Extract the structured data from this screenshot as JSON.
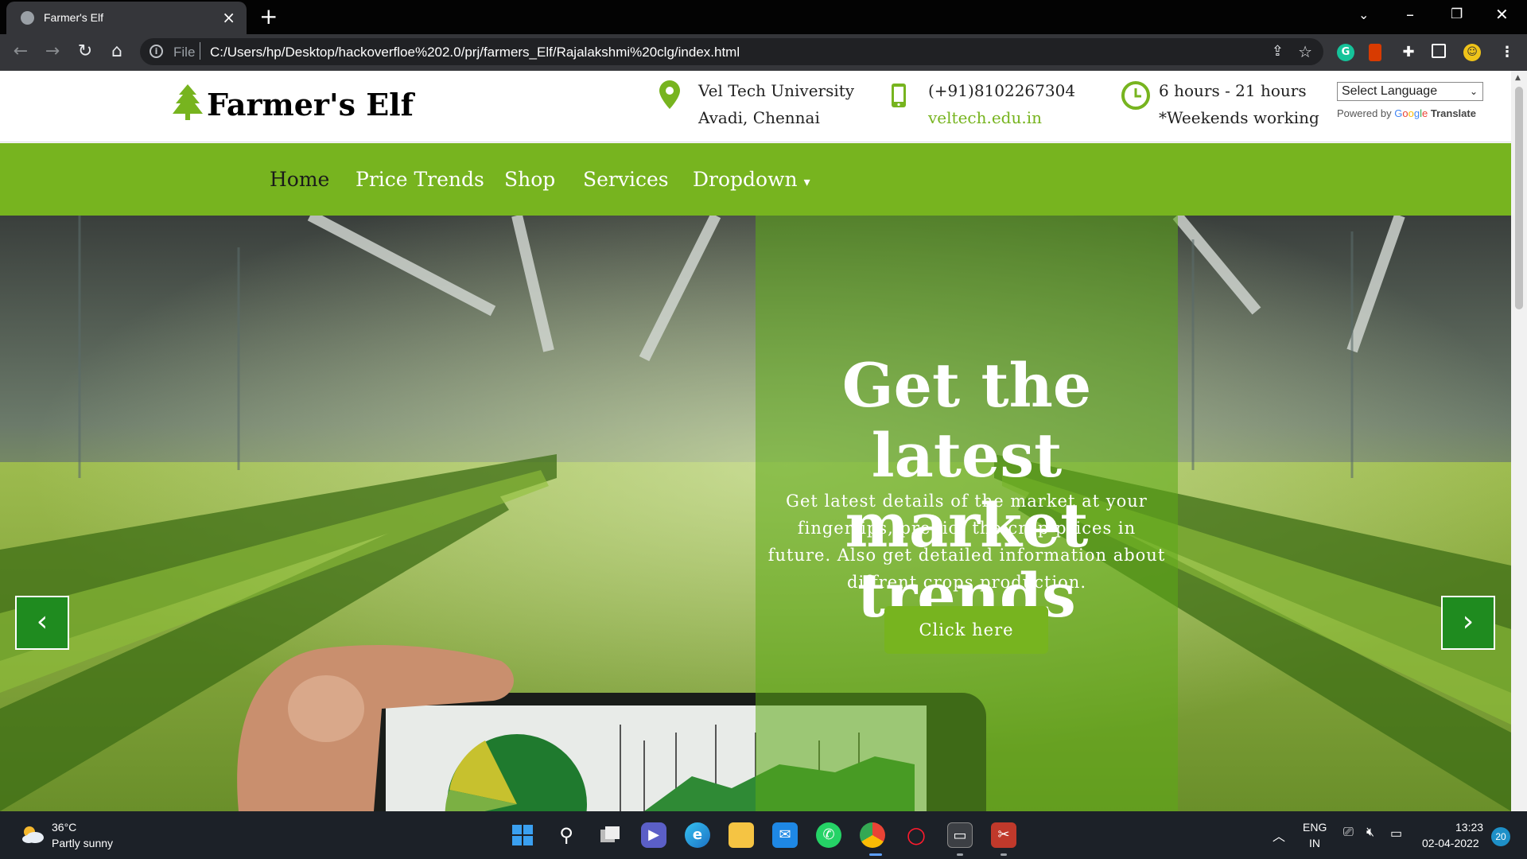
{
  "browser": {
    "tab_title": "Farmer's Elf",
    "url_scheme": "File",
    "url": "C:/Users/hp/Desktop/hackoverfloe%202.0/prj/farmers_Elf/Rajalakshmi%20clg/index.html"
  },
  "site": {
    "logo_text": "Farmer's Elf",
    "contact": {
      "address_line1": "Vel Tech University",
      "address_line2": "Avadi, Chennai",
      "phone": "(+91)8102267304",
      "website": "veltech.edu.in",
      "hours": "6 hours - 21 hours",
      "hours_note": "*Weekends working"
    },
    "translate": {
      "select_label": "Select Language",
      "powered_by": "Powered by",
      "google": [
        "G",
        "o",
        "o",
        "g",
        "l",
        "e"
      ],
      "translate_word": "Translate"
    },
    "nav": {
      "items": [
        {
          "label": "Home",
          "active": true
        },
        {
          "label": "Price Trends"
        },
        {
          "label": "Shop"
        },
        {
          "label": "Services"
        },
        {
          "label": "Dropdown"
        }
      ],
      "dropdown_caret": "▾"
    },
    "hero": {
      "title_line1": "Get the latest",
      "title_line2": "market trends",
      "text": "Get latest details of the market at your fingertips, predict the crop prices in future. Also get detailed information about diffrent crops production.",
      "button": "Click here",
      "prev_icon": "‹",
      "next_icon": "›"
    },
    "colors": {
      "brand_green": "#77b41f",
      "carousel_green": "#1f8b1f"
    }
  },
  "taskbar": {
    "weather_temp": "36°C",
    "weather_desc": "Partly sunny",
    "lang_line1": "ENG",
    "lang_line2": "IN",
    "time": "13:23",
    "date": "02-04-2022",
    "notifications": "20"
  }
}
